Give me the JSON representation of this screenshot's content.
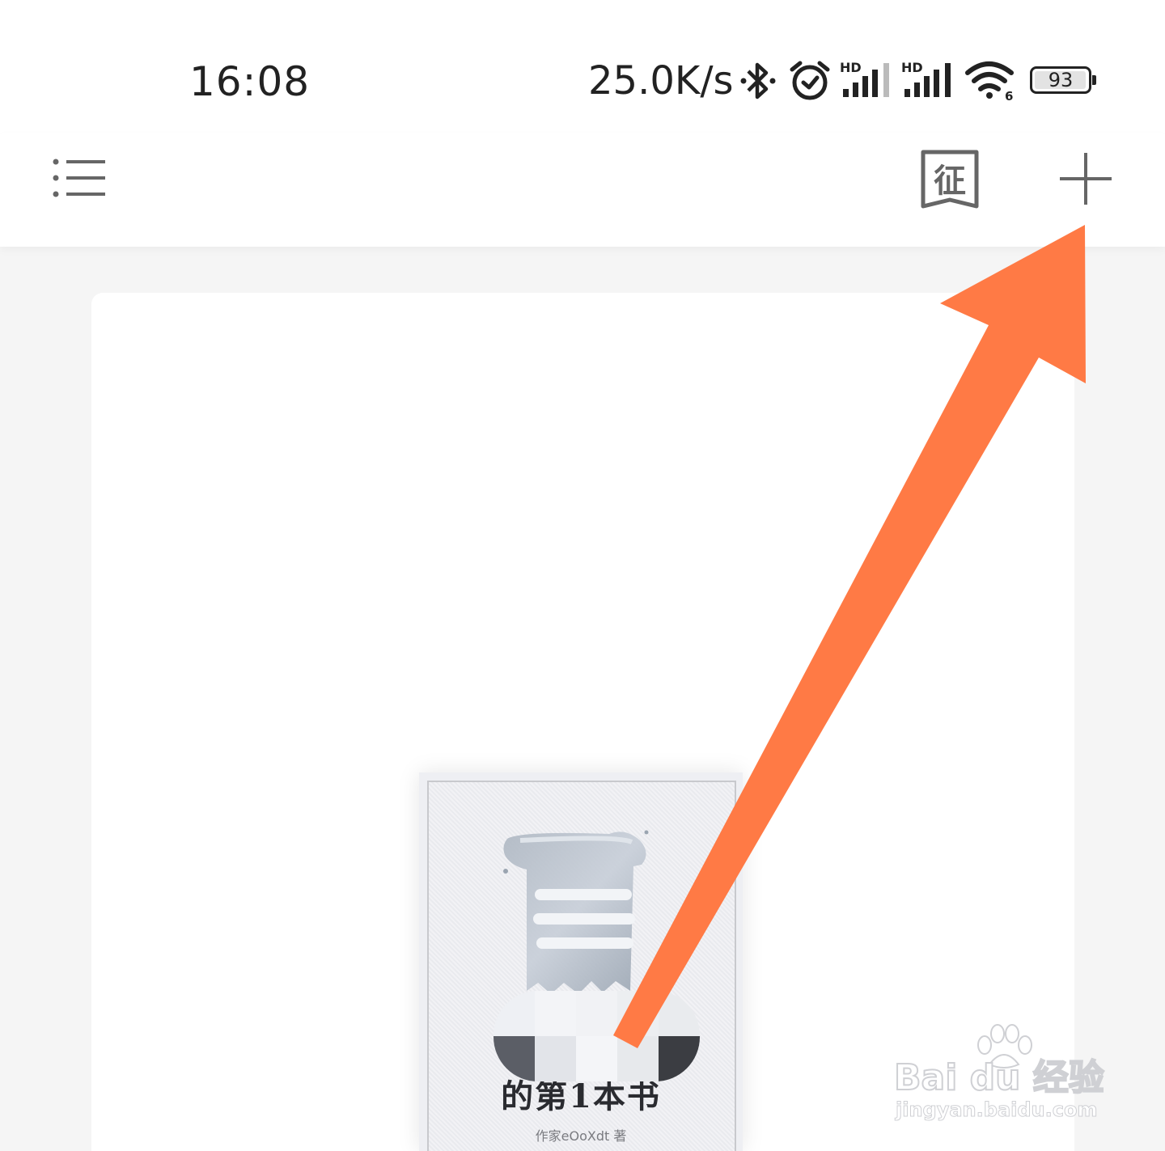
{
  "status_bar": {
    "time": "16:08",
    "net_speed": "25.0K/s",
    "battery": "93",
    "signal_label": "HD",
    "wifi_label": "6",
    "icons": [
      "bluetooth-icon",
      "alarm-icon",
      "signal-hd-icon",
      "signal-hd-icon",
      "wifi-6-icon",
      "battery-icon"
    ]
  },
  "topbar": {
    "menu_icon": "list-menu-icon",
    "contest_icon_char": "征",
    "add_icon": "plus-icon"
  },
  "book": {
    "title": "的第1本书",
    "author": "作家eOoXdt 著"
  },
  "watermark": {
    "brand": "Bai du 经验",
    "url": "jingyan.baidu.com"
  },
  "colors": {
    "arrow": "#ff7a45",
    "icon_gray": "#555555"
  }
}
